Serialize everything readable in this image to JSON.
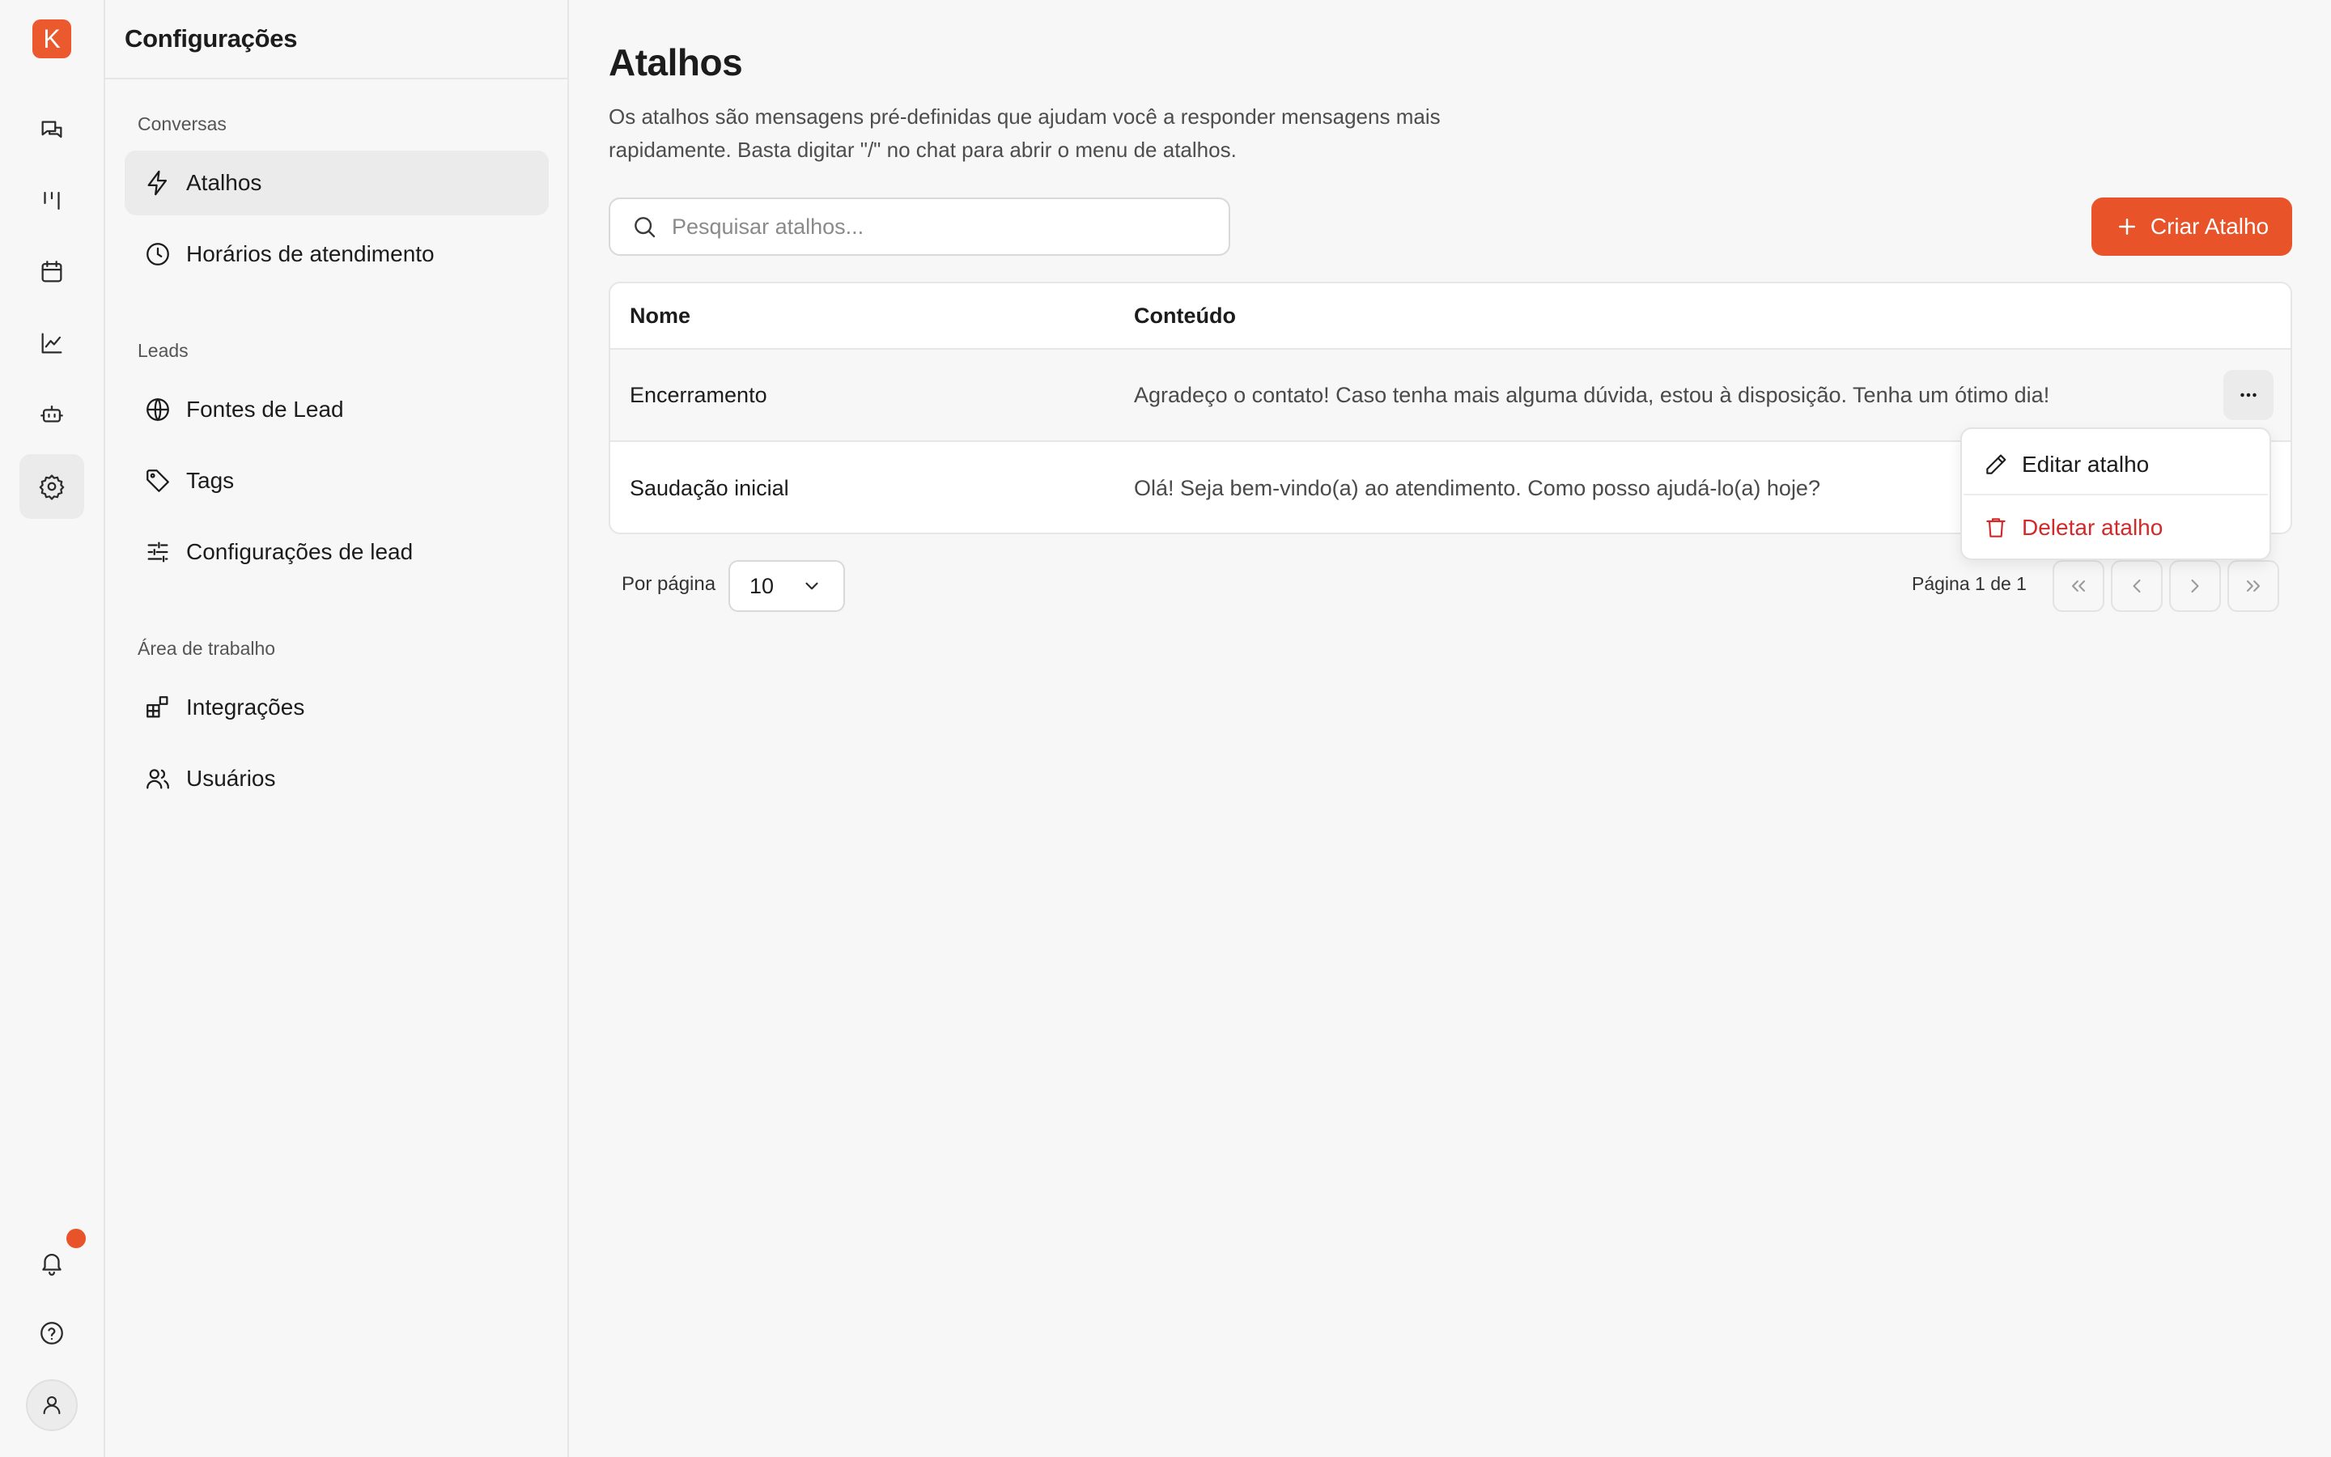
{
  "rail": {
    "logo_letter": "K",
    "items": [
      {
        "icon": "chat-icon"
      },
      {
        "icon": "kanban-icon"
      },
      {
        "icon": "calendar-icon"
      },
      {
        "icon": "chart-icon"
      },
      {
        "icon": "bot-icon"
      },
      {
        "icon": "gear-icon",
        "active": true
      }
    ],
    "bottom": [
      {
        "icon": "bell-icon",
        "has_notification": true
      },
      {
        "icon": "help-icon"
      },
      {
        "icon": "user-icon"
      }
    ]
  },
  "settings": {
    "title": "Configurações",
    "groups": [
      {
        "title": "Conversas",
        "items": [
          {
            "label": "Atalhos",
            "icon": "bolt-icon",
            "active": true
          },
          {
            "label": "Horários de atendimento",
            "icon": "clock-icon"
          }
        ]
      },
      {
        "title": "Leads",
        "items": [
          {
            "label": "Fontes de Lead",
            "icon": "globe-icon"
          },
          {
            "label": "Tags",
            "icon": "tag-icon"
          },
          {
            "label": "Configurações de lead",
            "icon": "sliders-icon"
          }
        ]
      },
      {
        "title": "Área de trabalho",
        "items": [
          {
            "label": "Integrações",
            "icon": "integrations-icon"
          },
          {
            "label": "Usuários",
            "icon": "users-icon"
          }
        ]
      }
    ]
  },
  "main": {
    "title": "Atalhos",
    "description": "Os atalhos são mensagens pré-definidas que ajudam você a responder mensagens mais rapidamente. Basta digitar \"/\" no chat para abrir o menu de atalhos.",
    "search_placeholder": "Pesquisar atalhos...",
    "search_value": "",
    "create_button": "Criar Atalho",
    "accent_color": "#e8532a",
    "table": {
      "columns": [
        "Nome",
        "Conteúdo"
      ],
      "rows": [
        {
          "name": "Encerramento",
          "content": "Agradeço o contato! Caso tenha mais alguma dúvida, estou à disposição. Tenha um ótimo dia!"
        },
        {
          "name": "Saudação inicial",
          "content": "Olá! Seja bem-vindo(a) ao atendimento. Como posso ajudá-lo(a) hoje?"
        }
      ]
    },
    "row_menu": {
      "edit_label": "Editar atalho",
      "delete_label": "Deletar atalho",
      "delete_color": "#d22a2a"
    },
    "pagination": {
      "per_page_label": "Por página",
      "per_page_value": "10",
      "page_info": "Página 1 de 1"
    }
  }
}
